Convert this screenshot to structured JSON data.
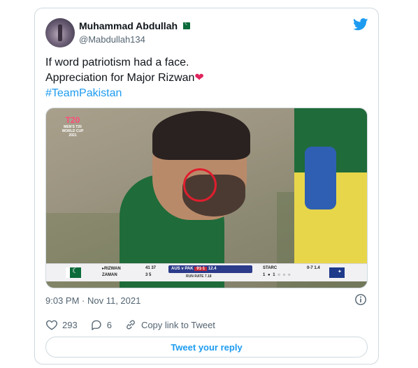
{
  "author": {
    "name": "Muhammad Abdullah",
    "handle": "@Mabdullah134",
    "flag_icon": "pakistan-flag-emoji"
  },
  "tweet": {
    "line1": "If word patriotism had a face.",
    "line2": "Appreciation for Major Rizwan",
    "heart": "❤",
    "hashtag": "#TeamPakistan"
  },
  "media": {
    "logo_text": "T20",
    "logo_sub": "MEN'S T20 WORLD CUP 2021",
    "scorebar": {
      "batter1": "▸RIZWAN",
      "batter1_runs": "41 37",
      "batter2": "ZAMAN",
      "batter2_runs": "3 5",
      "match": "AUS v PAK",
      "score": "91-1",
      "overs": "12.4",
      "run_rate": "RUN RATE 7.18",
      "bowler": "STARC",
      "bowler_figures": "0-7 1.4",
      "balls": "1 ● 1 ○ ○ ○"
    }
  },
  "meta": {
    "timestamp": "9:03 PM · Nov 11, 2021"
  },
  "actions": {
    "likes": "293",
    "replies": "6",
    "copy_link": "Copy link to Tweet"
  },
  "reply_button": "Tweet your reply",
  "colors": {
    "accent": "#1d9bf0",
    "text": "#0f1419",
    "muted": "#536471",
    "border": "#cfd9de",
    "heart": "#e0245e",
    "circle_mark": "#e01e2e"
  }
}
